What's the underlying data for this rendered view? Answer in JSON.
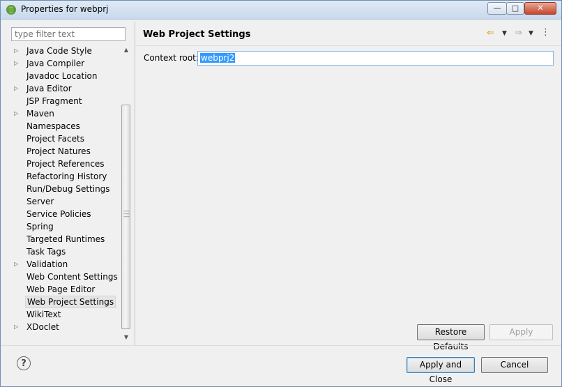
{
  "window": {
    "title": "Properties for webprj"
  },
  "filter": {
    "placeholder": "type filter text"
  },
  "tree": {
    "items": [
      {
        "label": "Java Code Style",
        "expandable": true
      },
      {
        "label": "Java Compiler",
        "expandable": true
      },
      {
        "label": "Javadoc Location",
        "expandable": false
      },
      {
        "label": "Java Editor",
        "expandable": true
      },
      {
        "label": "JSP Fragment",
        "expandable": false
      },
      {
        "label": "Maven",
        "expandable": true
      },
      {
        "label": "Namespaces",
        "expandable": false
      },
      {
        "label": "Project Facets",
        "expandable": false
      },
      {
        "label": "Project Natures",
        "expandable": false
      },
      {
        "label": "Project References",
        "expandable": false
      },
      {
        "label": "Refactoring History",
        "expandable": false
      },
      {
        "label": "Run/Debug Settings",
        "expandable": false
      },
      {
        "label": "Server",
        "expandable": false
      },
      {
        "label": "Service Policies",
        "expandable": false
      },
      {
        "label": "Spring",
        "expandable": false
      },
      {
        "label": "Targeted Runtimes",
        "expandable": false
      },
      {
        "label": "Task Tags",
        "expandable": false
      },
      {
        "label": "Validation",
        "expandable": true
      },
      {
        "label": "Web Content Settings",
        "expandable": false
      },
      {
        "label": "Web Page Editor",
        "expandable": false
      },
      {
        "label": "Web Project Settings",
        "expandable": false,
        "selected": true
      },
      {
        "label": "WikiText",
        "expandable": false
      },
      {
        "label": "XDoclet",
        "expandable": true
      }
    ]
  },
  "page": {
    "title": "Web Project Settings",
    "context_root_label": "Context root:",
    "context_root_value": "webprj2"
  },
  "buttons": {
    "restore_defaults": "Restore Defaults",
    "apply": "Apply",
    "apply_and_close": "Apply and Close",
    "cancel": "Cancel"
  },
  "icons": {
    "app": "eclipse-icon",
    "back": "arrow-left-icon",
    "forward": "arrow-right-icon",
    "view_menu": "kebab-menu-icon",
    "help": "help-icon"
  },
  "colors": {
    "selection": "#3399ff",
    "focus_border": "#7eb4ea",
    "back_arrow": "#e0a020"
  }
}
